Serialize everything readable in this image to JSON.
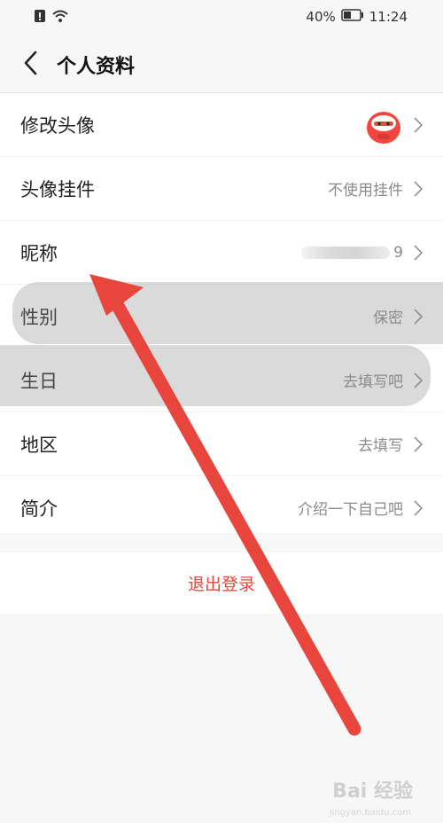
{
  "status_bar": {
    "battery": "40%",
    "time": "11:24"
  },
  "header": {
    "title": "个人资料"
  },
  "rows": [
    {
      "label": "修改头像",
      "value": ""
    },
    {
      "label": "头像挂件",
      "value": "不使用挂件"
    },
    {
      "label": "昵称",
      "value": "9"
    },
    {
      "label": "性别",
      "value": "保密"
    },
    {
      "label": "生日",
      "value": "去填写吧"
    },
    {
      "label": "地区",
      "value": "去填写"
    },
    {
      "label": "简介",
      "value": "介绍一下自己吧"
    }
  ],
  "logout": {
    "label": "退出登录"
  },
  "watermark": {
    "main": "Bai 经验",
    "sub": "jingyan.baidu.com"
  },
  "colors": {
    "accent": "#e4473f",
    "arrow": "#e8453c"
  }
}
